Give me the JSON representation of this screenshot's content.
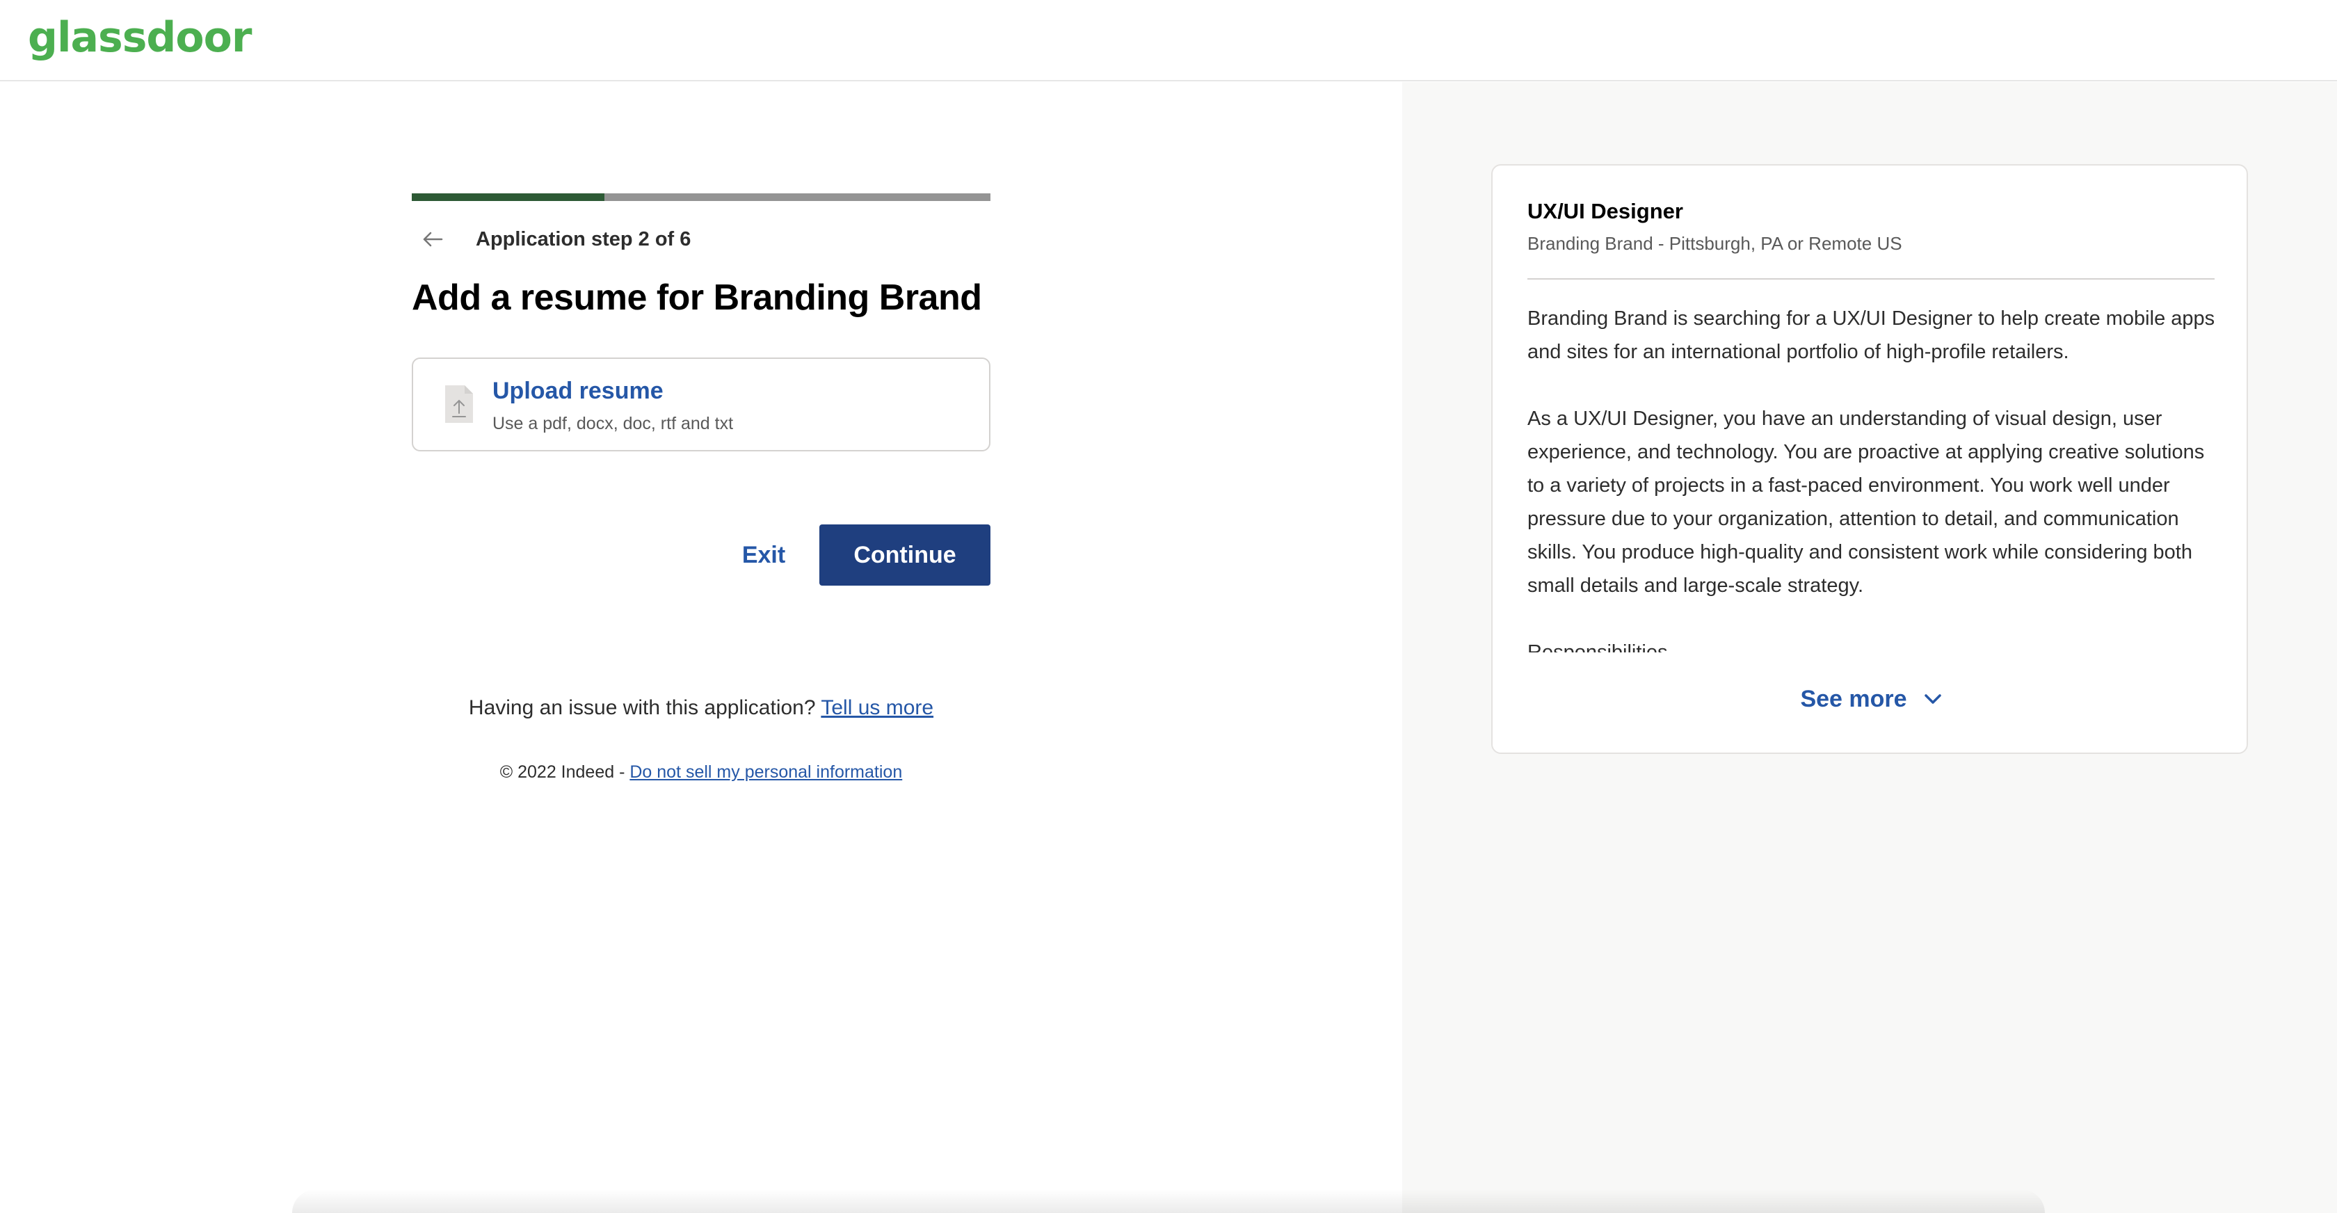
{
  "header": {
    "logo_text": "glassdoor"
  },
  "application": {
    "progress_fraction": 0.333,
    "step_label": "Application step 2 of 6",
    "title": "Add a resume for Branding Brand",
    "upload": {
      "title": "Upload resume",
      "hint": "Use a pdf, docx, doc, rtf and txt"
    },
    "exit_label": "Exit",
    "continue_label": "Continue",
    "issue_text": "Having an issue with this application?",
    "issue_link": "Tell us more",
    "footer_text": "© 2022 Indeed -",
    "footer_link": "Do not sell my personal information"
  },
  "job": {
    "title": "UX/UI Designer",
    "company_location": "Branding Brand - Pittsburgh, PA or Remote US",
    "description": [
      "Branding Brand is searching for a UX/UI Designer to help create mobile apps and sites for an international portfolio of high-profile retailers.",
      "As a UX/UI Designer, you have an understanding of visual design, user experience, and technology. You are proactive at applying creative solutions to a variety of projects in a fast-paced environment. You work well under pressure due to your organization, attention to detail, and communication skills. You produce high-quality and consistent work while considering both small details and large-scale strategy.",
      "Responsibilities"
    ],
    "see_more_label": "See more"
  },
  "colors": {
    "brand_green": "#4caf50",
    "progress_fill": "#2d5a35",
    "progress_track": "#949494",
    "link_blue": "#2557a7",
    "button_blue": "#1f3f7f"
  },
  "icons": {
    "back": "arrow-left-icon",
    "file": "file-upload-icon",
    "see_more": "chevron-down-icon"
  }
}
